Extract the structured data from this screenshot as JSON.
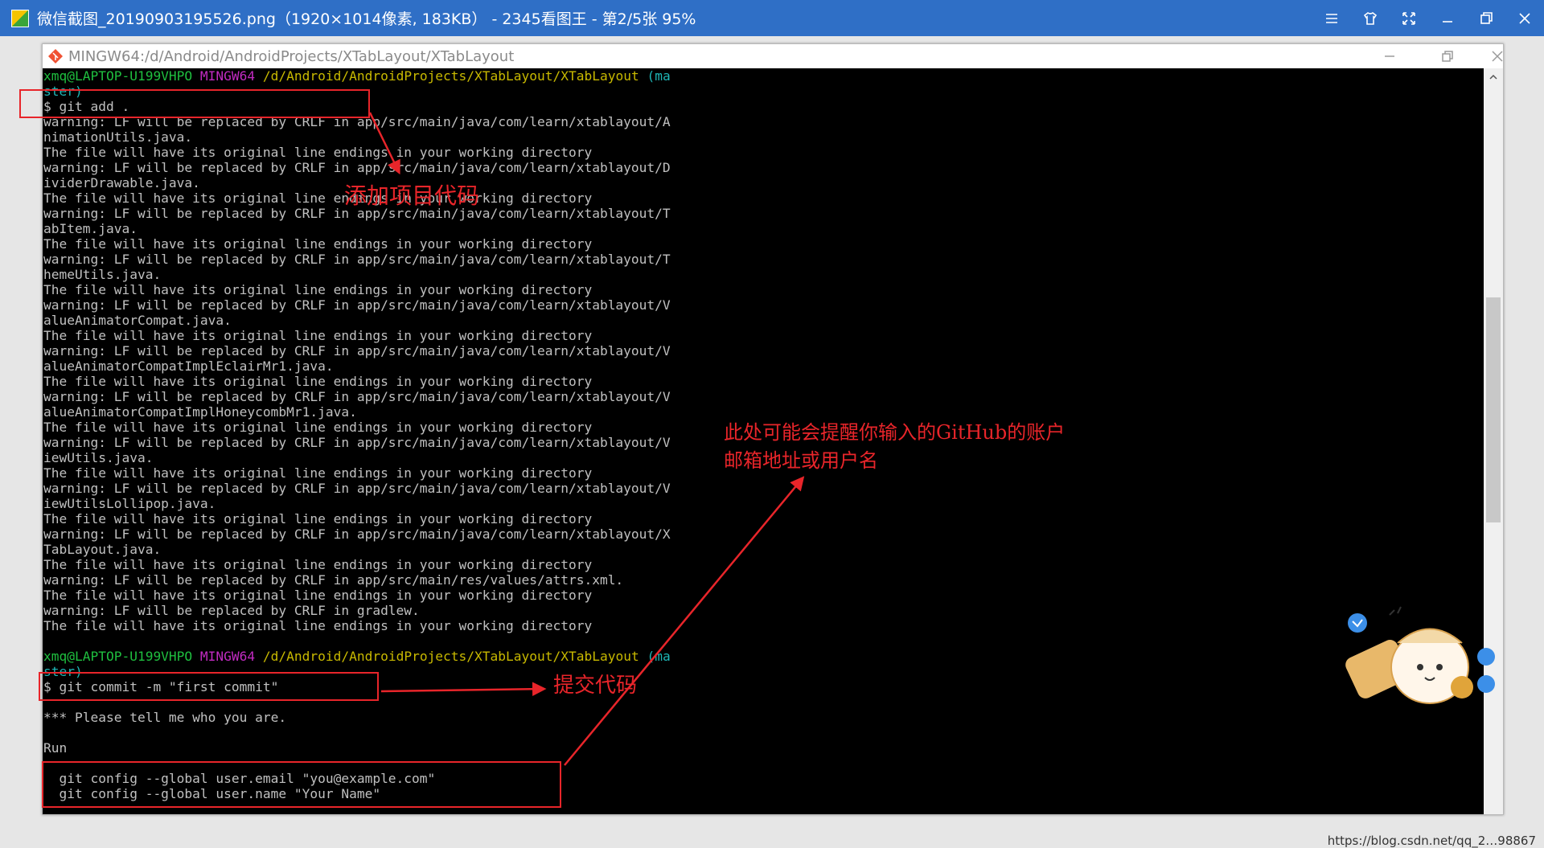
{
  "viewer": {
    "title": "微信截图_20190903195526.png（1920×1014像素, 183KB） - 2345看图王 - 第2/5张 95%"
  },
  "terminal": {
    "title": "MINGW64:/d/Android/AndroidProjects/XTabLayout/XTabLayout",
    "prompt1": {
      "user": "xmq@LAPTOP-U199VHPO",
      "shell": "MINGW64",
      "path": "/d/Android/AndroidProjects/XTabLayout/XTabLayout",
      "branch_open": "(ma",
      "branch_close": "ster)"
    },
    "cmd1": "$ git add .",
    "add_output": [
      "warning: LF will be replaced by CRLF in app/src/main/java/com/learn/xtablayout/A",
      "nimationUtils.java.",
      "The file will have its original line endings in your working directory",
      "warning: LF will be replaced by CRLF in app/src/main/java/com/learn/xtablayout/D",
      "ividerDrawable.java.",
      "The file will have its original line endings in your working directory",
      "warning: LF will be replaced by CRLF in app/src/main/java/com/learn/xtablayout/T",
      "abItem.java.",
      "The file will have its original line endings in your working directory",
      "warning: LF will be replaced by CRLF in app/src/main/java/com/learn/xtablayout/T",
      "hemeUtils.java.",
      "The file will have its original line endings in your working directory",
      "warning: LF will be replaced by CRLF in app/src/main/java/com/learn/xtablayout/V",
      "alueAnimatorCompat.java.",
      "The file will have its original line endings in your working directory",
      "warning: LF will be replaced by CRLF in app/src/main/java/com/learn/xtablayout/V",
      "alueAnimatorCompatImplEclairMr1.java.",
      "The file will have its original line endings in your working directory",
      "warning: LF will be replaced by CRLF in app/src/main/java/com/learn/xtablayout/V",
      "alueAnimatorCompatImplHoneycombMr1.java.",
      "The file will have its original line endings in your working directory",
      "warning: LF will be replaced by CRLF in app/src/main/java/com/learn/xtablayout/V",
      "iewUtils.java.",
      "The file will have its original line endings in your working directory",
      "warning: LF will be replaced by CRLF in app/src/main/java/com/learn/xtablayout/V",
      "iewUtilsLollipop.java.",
      "The file will have its original line endings in your working directory",
      "warning: LF will be replaced by CRLF in app/src/main/java/com/learn/xtablayout/X",
      "TabLayout.java.",
      "The file will have its original line endings in your working directory",
      "warning: LF will be replaced by CRLF in app/src/main/res/values/attrs.xml.",
      "The file will have its original line endings in your working directory",
      "warning: LF will be replaced by CRLF in gradlew.",
      "The file will have its original line endings in your working directory"
    ],
    "cmd2": "$ git commit -m \"first commit\"",
    "commit_output": {
      "tell": "*** Please tell me who you are.",
      "run": "Run",
      "config_email": "  git config --global user.email \"you@example.com\"",
      "config_name": "  git config --global user.name \"Your Name\""
    }
  },
  "annotations": {
    "add_code": "添加项目代码",
    "commit_code": "提交代码",
    "github_hint_line1": "此处可能会提醒你输入的GitHub的账户",
    "github_hint_line2": "邮箱地址或用户名"
  },
  "watermark": "https://blog.csdn.net/qq_2…98867",
  "colors": {
    "annotation": "#e8252a",
    "prompt_user": "#1fbf3f",
    "prompt_shell": "#c22bc2",
    "prompt_path": "#c8b900",
    "prompt_branch": "#1eb6b6",
    "viewer_titlebar": "#2f6fc6"
  },
  "icons": {
    "viewer_controls": [
      "menu-icon",
      "skin-icon",
      "fullscreen-icon",
      "minimize-icon",
      "maximize-icon",
      "close-icon"
    ],
    "terminal_controls": [
      "minimize-icon",
      "restore-icon",
      "close-icon"
    ]
  }
}
